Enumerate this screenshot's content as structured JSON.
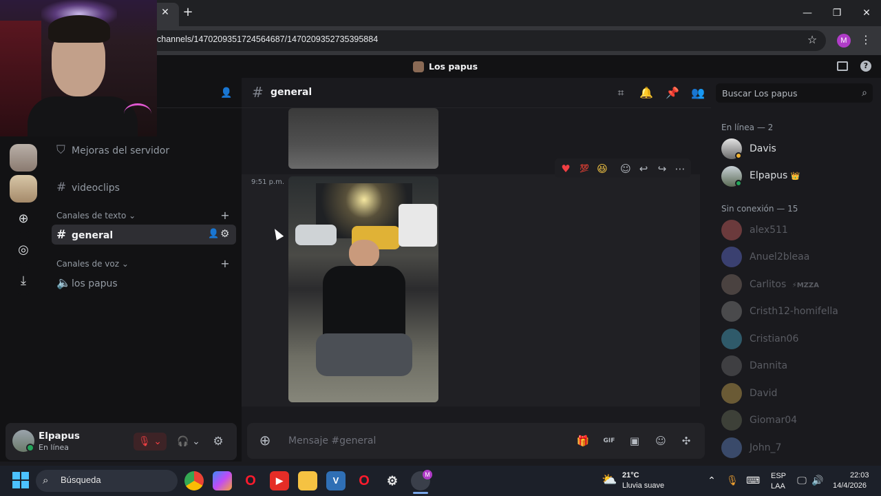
{
  "browser": {
    "tab_close": "✕",
    "new_tab": "+",
    "url": "channels/1470209351724564687/1470209352735395884",
    "profile_initial": "M",
    "window_controls": [
      "—",
      "❐",
      "✕"
    ]
  },
  "discord": {
    "server_name": "Los papus",
    "sidebar": {
      "boost_item": "Mejoras del servidor",
      "channels_top": [
        {
          "label": "videoclips"
        }
      ],
      "text_category": "Canales de texto",
      "text_channels": [
        {
          "label": "general"
        }
      ],
      "voice_category": "Canales de voz",
      "voice_channels": [
        {
          "label": "los papus"
        }
      ]
    },
    "user": {
      "name": "Elpapus",
      "status": "En línea"
    },
    "chat": {
      "channel": "general",
      "timestamp": "9:51 p.m.",
      "composer_placeholder": "Mensaje #general"
    },
    "search_placeholder": "Buscar Los papus",
    "members": {
      "online_header": "En línea — 2",
      "online": [
        {
          "name": "Davis",
          "color": "#f2f3f5"
        },
        {
          "name": "Elpapus",
          "color": "#f2f3f5",
          "badge": "👑"
        }
      ],
      "offline_header": "Sin conexión — 15",
      "offline": [
        {
          "name": "alex511"
        },
        {
          "name": "Anuel2bleaa"
        },
        {
          "name": "Carlitos",
          "tag": "MZZA"
        },
        {
          "name": "Cristh12-homifella"
        },
        {
          "name": "Cristian06"
        },
        {
          "name": "Dannita"
        },
        {
          "name": "David"
        },
        {
          "name": "Giomar04"
        },
        {
          "name": "John_7"
        }
      ]
    },
    "colors": {
      "accent": "#5865f2",
      "online": "#23a55a",
      "muted_red": "#f23f43"
    }
  },
  "taskbar": {
    "search": "Búsqueda",
    "weather_temp": "21°C",
    "weather_desc": "Lluvia suave",
    "lang_top": "ESP",
    "lang_bottom": "LAA",
    "time": "22:03",
    "date": "14/4/2026",
    "profile_badge": "M"
  }
}
